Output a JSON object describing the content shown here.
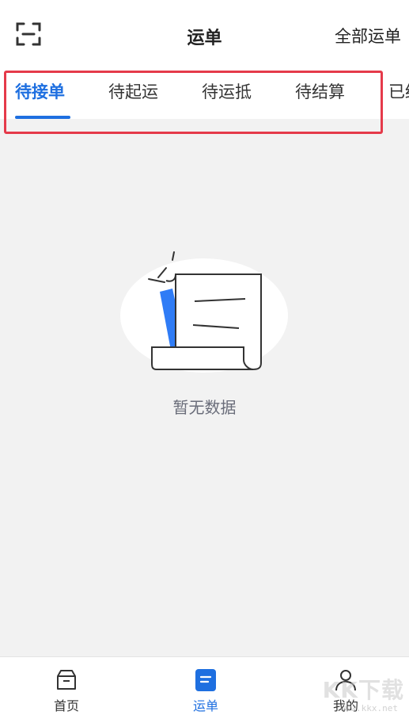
{
  "header": {
    "title": "运单",
    "all_orders_label": "全部运单",
    "scan_icon": "scan-icon"
  },
  "tabs": [
    {
      "label": "待接单",
      "active": true
    },
    {
      "label": "待起运",
      "active": false
    },
    {
      "label": "待运抵",
      "active": false
    },
    {
      "label": "待结算",
      "active": false
    },
    {
      "label": "已结",
      "active": false
    }
  ],
  "empty_state": {
    "icon": "empty-document-icon",
    "message": "暂无数据"
  },
  "bottom_nav": [
    {
      "label": "首页",
      "icon": "box-icon",
      "active": false
    },
    {
      "label": "运单",
      "icon": "document-icon",
      "active": true
    },
    {
      "label": "我的",
      "icon": "user-icon",
      "active": false
    }
  ],
  "watermark": {
    "text": "KK下载",
    "url": "www.kkx.net"
  },
  "colors": {
    "accent": "#1e6fe0",
    "highlight_border": "#e53a4a",
    "page_background": "#f2f2f2",
    "empty_text": "#6a6d7a"
  }
}
